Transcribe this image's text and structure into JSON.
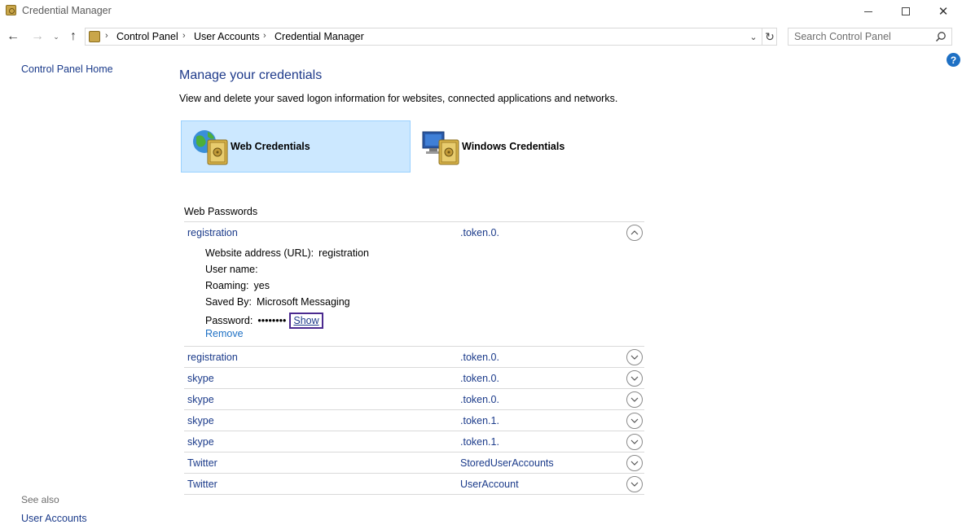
{
  "window": {
    "title": "Credential Manager",
    "minimize_icon": "minimize-icon",
    "maximize_icon": "maximize-icon",
    "close_glyph": "✕"
  },
  "nav": {
    "back_glyph": "←",
    "forward_glyph": "→",
    "recent_glyph": "⌄",
    "up_glyph": "↑"
  },
  "address": {
    "crumbs": [
      "Control Panel",
      "User Accounts",
      "Credential Manager"
    ],
    "sep_glyph": "›",
    "dropdown_glyph": "⌄",
    "refresh_glyph": "↻"
  },
  "search": {
    "placeholder": "Search Control Panel"
  },
  "help": {
    "glyph": "?"
  },
  "left_nav": {
    "home": "Control Panel Home",
    "see_also": "See also",
    "user_accounts": "User Accounts"
  },
  "main": {
    "title": "Manage your credentials",
    "description": "View and delete your saved logon information for websites, connected applications and networks.",
    "tiles": {
      "web": "Web Credentials",
      "windows": "Windows Credentials"
    },
    "section_heading": "Web Passwords",
    "expanded": {
      "name": "registration",
      "kind": ".token.0.",
      "url_label": "Website address (URL):",
      "url_value": "registration",
      "username_label": "User name:",
      "username_value": "",
      "roaming_label": "Roaming:",
      "roaming_value": "yes",
      "savedby_label": "Saved By:",
      "savedby_value": "Microsoft Messaging",
      "password_label": "Password:",
      "password_value": "••••••••",
      "show_label": "Show",
      "remove_label": "Remove"
    },
    "rows": [
      {
        "name": "registration",
        "kind": ".token.0."
      },
      {
        "name": "skype",
        "kind": ".token.0."
      },
      {
        "name": "skype",
        "kind": ".token.0."
      },
      {
        "name": "skype",
        "kind": ".token.1."
      },
      {
        "name": "skype",
        "kind": ".token.1."
      },
      {
        "name": "Twitter",
        "kind": "StoredUserAccounts"
      },
      {
        "name": "Twitter",
        "kind": "UserAccount"
      }
    ]
  },
  "colors": {
    "link": "#1a3a8a",
    "selected_tile": "#cce8ff",
    "focus_outline": "#4b2a8f"
  }
}
